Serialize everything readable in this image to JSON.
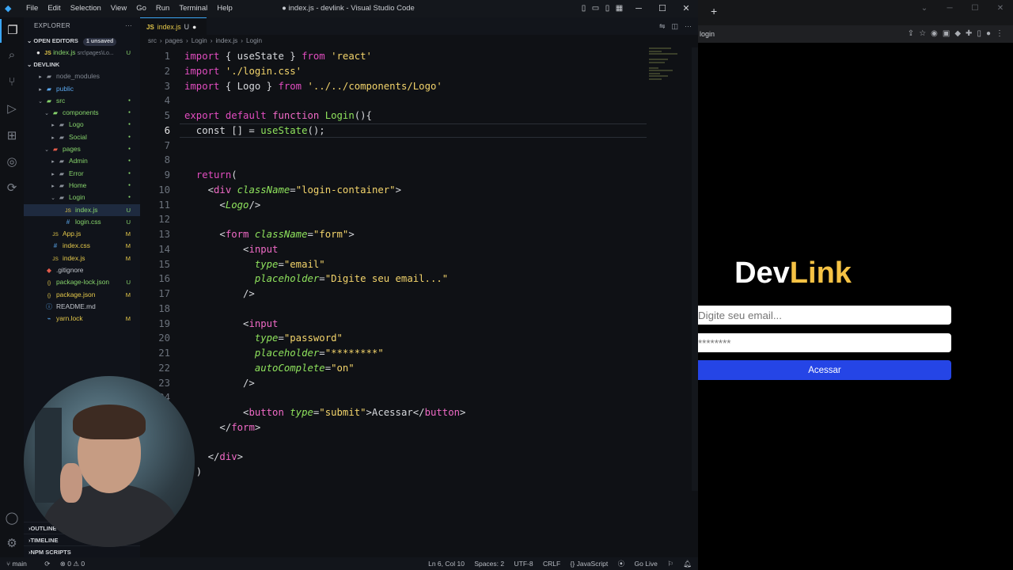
{
  "vscode": {
    "menu": [
      "File",
      "Edit",
      "Selection",
      "View",
      "Go",
      "Run",
      "Terminal",
      "Help"
    ],
    "window_title": "● index.js - devlink - Visual Studio Code",
    "explorer_title": "EXPLORER",
    "open_editors": {
      "label": "OPEN EDITORS",
      "badge": "1 unsaved",
      "file": "index.js",
      "path": "src\\pages\\Lo...",
      "status": "U"
    },
    "project": "DEVLINK",
    "tree": [
      {
        "label": "node_modules",
        "depth": 1,
        "kind": "folder",
        "status": "",
        "color": "grey"
      },
      {
        "label": "public",
        "depth": 1,
        "kind": "folder",
        "status": "",
        "color": "blue"
      },
      {
        "label": "src",
        "depth": 1,
        "kind": "folder-open",
        "status": "",
        "color": "green"
      },
      {
        "label": "components",
        "depth": 2,
        "kind": "folder-open",
        "status": "",
        "color": "green"
      },
      {
        "label": "Logo",
        "depth": 3,
        "kind": "folder",
        "status": "",
        "color": "green"
      },
      {
        "label": "Social",
        "depth": 3,
        "kind": "folder",
        "status": "",
        "color": "green"
      },
      {
        "label": "pages",
        "depth": 2,
        "kind": "folder-open",
        "status": "",
        "color": "green"
      },
      {
        "label": "Admin",
        "depth": 3,
        "kind": "folder",
        "status": "",
        "color": "green"
      },
      {
        "label": "Error",
        "depth": 3,
        "kind": "folder",
        "status": "",
        "color": "green"
      },
      {
        "label": "Home",
        "depth": 3,
        "kind": "folder",
        "status": "",
        "color": "green"
      },
      {
        "label": "Login",
        "depth": 3,
        "kind": "folder-open",
        "status": "",
        "color": "green"
      },
      {
        "label": "index.js",
        "depth": 4,
        "kind": "js",
        "status": "U",
        "color": "green",
        "selected": true
      },
      {
        "label": "login.css",
        "depth": 4,
        "kind": "css",
        "status": "U",
        "color": "green"
      },
      {
        "label": "App.js",
        "depth": 2,
        "kind": "js",
        "status": "M",
        "color": "yellow"
      },
      {
        "label": "index.css",
        "depth": 2,
        "kind": "css",
        "status": "M",
        "color": "yellow"
      },
      {
        "label": "index.js",
        "depth": 2,
        "kind": "js",
        "status": "M",
        "color": "yellow"
      },
      {
        "label": ".gitignore",
        "depth": 1,
        "kind": "git",
        "status": "",
        "color": "default"
      },
      {
        "label": "package-lock.json",
        "depth": 1,
        "kind": "json",
        "status": "U",
        "color": "green"
      },
      {
        "label": "package.json",
        "depth": 1,
        "kind": "json",
        "status": "M",
        "color": "yellow"
      },
      {
        "label": "README.md",
        "depth": 1,
        "kind": "info",
        "status": "",
        "color": "default"
      },
      {
        "label": "yarn.lock",
        "depth": 1,
        "kind": "yarn",
        "status": "M",
        "color": "yellow"
      }
    ],
    "bottom_sections": [
      "OUTLINE",
      "TIMELINE",
      "NPM SCRIPTS"
    ],
    "tab": {
      "label": "index.js",
      "status": "U"
    },
    "breadcrumb": [
      "src",
      "pages",
      "Login",
      "index.js",
      "Login"
    ],
    "code": [
      {
        "n": "1",
        "tokens": [
          [
            "imp",
            "import"
          ],
          [
            "dflt",
            " { useState } "
          ],
          [
            "imp",
            "from"
          ],
          [
            "dflt",
            " "
          ],
          [
            "str",
            "'react'"
          ]
        ]
      },
      {
        "n": "2",
        "tokens": [
          [
            "imp",
            "import"
          ],
          [
            "dflt",
            " "
          ],
          [
            "str",
            "'./login.css'"
          ]
        ]
      },
      {
        "n": "3",
        "tokens": [
          [
            "imp",
            "import"
          ],
          [
            "dflt",
            " { Logo } "
          ],
          [
            "imp",
            "from"
          ],
          [
            "dflt",
            " "
          ],
          [
            "str",
            "'../../components/Logo'"
          ]
        ]
      },
      {
        "n": "4",
        "tokens": []
      },
      {
        "n": "5",
        "tokens": [
          [
            "imp",
            "export"
          ],
          [
            "dflt",
            " "
          ],
          [
            "imp",
            "default"
          ],
          [
            "dflt",
            " "
          ],
          [
            "kw",
            "function"
          ],
          [
            "dflt",
            " "
          ],
          [
            "fn",
            "Login"
          ],
          [
            "dflt",
            "(){"
          ]
        ]
      },
      {
        "n": "6",
        "tokens": [
          [
            "dflt",
            "  const [] = "
          ],
          [
            "fn",
            "useState"
          ],
          [
            "dflt",
            "();"
          ]
        ]
      },
      {
        "n": "7",
        "tokens": []
      },
      {
        "n": "8",
        "tokens": []
      },
      {
        "n": "9",
        "tokens": [
          [
            "dflt",
            "  "
          ],
          [
            "imp",
            "return"
          ],
          [
            "dflt",
            "("
          ]
        ]
      },
      {
        "n": "10",
        "tokens": [
          [
            "dflt",
            "    <"
          ],
          [
            "tag",
            "div"
          ],
          [
            "dflt",
            " "
          ],
          [
            "attr",
            "className"
          ],
          [
            "dflt",
            "="
          ],
          [
            "str",
            "\"login-container\""
          ],
          [
            "dflt",
            ">"
          ]
        ]
      },
      {
        "n": "11",
        "tokens": [
          [
            "dflt",
            "      <"
          ],
          [
            "attr",
            "Logo"
          ],
          [
            "dflt",
            "/>"
          ]
        ]
      },
      {
        "n": "12",
        "tokens": []
      },
      {
        "n": "13",
        "tokens": [
          [
            "dflt",
            "      <"
          ],
          [
            "tag",
            "form"
          ],
          [
            "dflt",
            " "
          ],
          [
            "attr",
            "className"
          ],
          [
            "dflt",
            "="
          ],
          [
            "str",
            "\"form\""
          ],
          [
            "dflt",
            ">"
          ]
        ]
      },
      {
        "n": "14",
        "tokens": [
          [
            "dflt",
            "          <"
          ],
          [
            "tag",
            "input"
          ]
        ]
      },
      {
        "n": "15",
        "tokens": [
          [
            "dflt",
            "            "
          ],
          [
            "attr",
            "type"
          ],
          [
            "dflt",
            "="
          ],
          [
            "str",
            "\"email\""
          ]
        ]
      },
      {
        "n": "16",
        "tokens": [
          [
            "dflt",
            "            "
          ],
          [
            "attr",
            "placeholder"
          ],
          [
            "dflt",
            "="
          ],
          [
            "str",
            "\"Digite seu email...\""
          ]
        ]
      },
      {
        "n": "17",
        "tokens": [
          [
            "dflt",
            "          />"
          ]
        ]
      },
      {
        "n": "18",
        "tokens": []
      },
      {
        "n": "19",
        "tokens": [
          [
            "dflt",
            "          <"
          ],
          [
            "tag",
            "input"
          ]
        ]
      },
      {
        "n": "20",
        "tokens": [
          [
            "dflt",
            "            "
          ],
          [
            "attr",
            "type"
          ],
          [
            "dflt",
            "="
          ],
          [
            "str",
            "\"password\""
          ]
        ]
      },
      {
        "n": "21",
        "tokens": [
          [
            "dflt",
            "            "
          ],
          [
            "attr",
            "placeholder"
          ],
          [
            "dflt",
            "="
          ],
          [
            "str",
            "\"********\""
          ]
        ]
      },
      {
        "n": "22",
        "tokens": [
          [
            "dflt",
            "            "
          ],
          [
            "attr",
            "autoComplete"
          ],
          [
            "dflt",
            "="
          ],
          [
            "str",
            "\"on\""
          ]
        ]
      },
      {
        "n": "23",
        "tokens": [
          [
            "dflt",
            "          />"
          ]
        ]
      },
      {
        "n": "24",
        "tokens": []
      },
      {
        "n": "25",
        "tokens": [
          [
            "dflt",
            "          <"
          ],
          [
            "tag",
            "button"
          ],
          [
            "dflt",
            " "
          ],
          [
            "attr",
            "type"
          ],
          [
            "dflt",
            "="
          ],
          [
            "str",
            "\"submit\""
          ],
          [
            "dflt",
            ">Acessar</"
          ],
          [
            "tag",
            "button"
          ],
          [
            "dflt",
            ">"
          ]
        ]
      },
      {
        "n": "26",
        "tokens": [
          [
            "dflt",
            "      </"
          ],
          [
            "tag",
            "form"
          ],
          [
            "dflt",
            ">"
          ]
        ]
      },
      {
        "n": "27",
        "tokens": []
      },
      {
        "n": "28",
        "tokens": [
          [
            "dflt",
            "    </"
          ],
          [
            "tag",
            "div"
          ],
          [
            "dflt",
            ">"
          ]
        ]
      },
      {
        "n": "29",
        "tokens": [
          [
            "dflt",
            "  )"
          ]
        ]
      }
    ],
    "current_line": "6",
    "status": {
      "branch": "main",
      "sync": "⟳",
      "problems": "⊗ 0 ⚠ 0",
      "position": "Ln 6, Col 10",
      "spaces": "Spaces: 2",
      "encoding": "UTF-8",
      "eol": "CRLF",
      "language": "{} JavaScript",
      "golive": "Go Live"
    }
  },
  "browser": {
    "new_tab": "+",
    "url": "login",
    "brand_dev": "Dev",
    "brand_link": "Link",
    "email_placeholder": "Digite seu email...",
    "password_placeholder": "********",
    "submit_label": "Acessar"
  },
  "colors": {
    "accent": "#3ba6f5",
    "brand_yellow": "#f5c244",
    "button_blue": "#2545e6"
  }
}
